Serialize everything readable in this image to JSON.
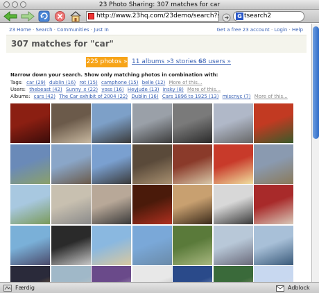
{
  "window": {
    "title": "23 Photo Sharing: 307 matches for car"
  },
  "toolbar": {
    "url": "http://www.23hq.com/23demo/search?search=car",
    "search_value": "tsearch2"
  },
  "topnav": {
    "items": [
      "23 Home",
      "Search",
      "Communities",
      "Just In"
    ],
    "right_items": [
      "Get a free 23 account",
      "Login",
      "Help"
    ]
  },
  "page": {
    "heading": "307 matches for \"car\"",
    "tabs": {
      "active": "225 photos »",
      "albums": "11 albums »",
      "stories": "3 stories »",
      "users": "68 users »"
    },
    "narrow_text": "Narrow down your search. Show only matching photos in combination with:",
    "filters": {
      "tags": {
        "label": "Tags:",
        "items": [
          "car (29)",
          "dublin (16)",
          "rot (15)",
          "camphone (15)",
          "belle (12)"
        ],
        "more": "More of this..."
      },
      "users": {
        "label": "Users:",
        "items": [
          "thebeast (42)",
          "Sunny_x (22)",
          "yoss (16)",
          "HeyJude (13)",
          "insky (8)"
        ],
        "more": "More of this..."
      },
      "albums": {
        "label": "Albums:",
        "items": [
          "cars (42)",
          "The Car exhibit of 2004 (22)",
          "Dublin (16)",
          "Cars 1896 to 1925 (13)",
          "miscnyc (7)"
        ],
        "more": "More of this..."
      }
    },
    "photos": [
      [
        "#8b1f12",
        "#3a0c0a"
      ],
      [
        "#6b5a4a",
        "#c8b8a0"
      ],
      [
        "#7da0c8",
        "#3a3a3a"
      ],
      [
        "#9aa0a8",
        "#3c3c3c"
      ],
      [
        "#7a7a7a",
        "#2a2a2a"
      ],
      [
        "#b0b8c8",
        "#666"
      ],
      [
        "#c23a22",
        "#3a5a2a"
      ],
      [
        "#6a8ab8",
        "#8aa06a"
      ],
      [
        "#8aa6c8",
        "#6a5a4a"
      ],
      [
        "#7aa0d0",
        "#3a3a3a"
      ],
      [
        "#5a4a3a",
        "#a89070"
      ],
      [
        "#8a3a2a",
        "#d8c8a8"
      ],
      [
        "#c83a2a",
        "#f0e0a0"
      ],
      [
        "#8a9ab0",
        "#8a7a5a"
      ],
      [
        "#a8c8e0",
        "#7a9a5a"
      ],
      [
        "#c8c0b0",
        "#8a8a8a"
      ],
      [
        "#b8a898",
        "#3a3a3a"
      ],
      [
        "#4a1a0a",
        "#b03020"
      ],
      [
        "#c8a070",
        "#3a2a1a"
      ],
      [
        "#d8d8d8",
        "#3a3a3a"
      ],
      [
        "#a82a2a",
        "#d8c8b8"
      ],
      [
        "#7ab0d8",
        "#4a4a6a"
      ],
      [
        "#2a2a2a",
        "#c8c8c8"
      ],
      [
        "#8ab8e0",
        "#d8c8a0"
      ],
      [
        "#7aa8d8",
        "#6a8aa8"
      ],
      [
        "#5a7a3a",
        "#a8b880"
      ],
      [
        "#b8c8d8",
        "#6a6a7a"
      ],
      [
        "#a8c0d8",
        "#3a5a7a"
      ],
      [
        "#2a2a3a",
        "#d8a040"
      ],
      [
        "#a0b8c8",
        "#d8d0c0"
      ],
      [
        "#6a4a8a",
        "#f0f0f0"
      ],
      [
        "#e8e8e8",
        "#888"
      ],
      [
        "#2a4a8a",
        "#d8e0f0"
      ],
      [
        "#3a6a3a",
        "#d8c0a0"
      ],
      [
        "#c8d8f0",
        "#e0e0e0"
      ]
    ]
  },
  "statusbar": {
    "text": "Færdig",
    "adblock": "Adblock"
  }
}
